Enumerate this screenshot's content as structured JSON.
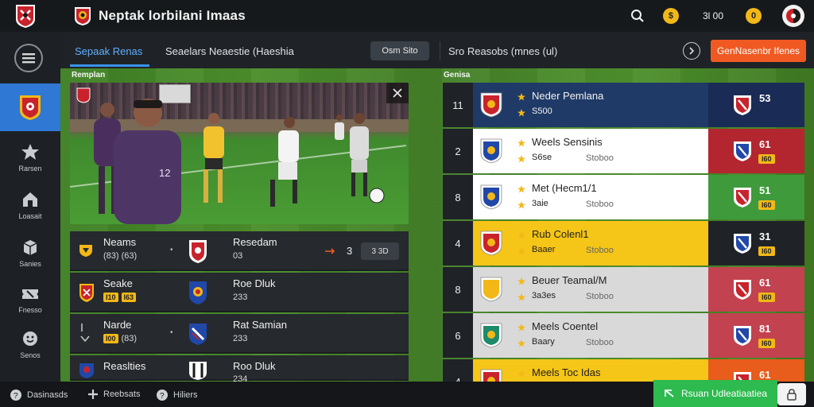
{
  "app": {
    "title": "Neptak lorbilani Imaas"
  },
  "top_bar": {
    "balance": "3l 00",
    "coin_glyph": "$",
    "coin2_glyph": "0"
  },
  "rail": {
    "items": [
      {
        "label": "Rarsen",
        "icon": "star-icon"
      },
      {
        "label": "Loasait",
        "icon": "house-icon"
      },
      {
        "label": "Sanies",
        "icon": "box-icon"
      },
      {
        "label": "Fnesso",
        "icon": "ticket-icon"
      },
      {
        "label": "Senos",
        "icon": "smile-icon"
      }
    ]
  },
  "subnav": {
    "tab_active": "Sepaak Renas",
    "tab_2": "Seaelars Neaestie (Haeshia",
    "pill": "Osm Sito",
    "info": "Sro Reasobs (mnes (ul)",
    "cta": "GenNasenbr Ifenes"
  },
  "labels": {
    "video_section": "Remplan",
    "standings_section": "Genisa"
  },
  "matches": [
    {
      "name": "Neams",
      "sub": "(83) (63)",
      "team": "Resedam",
      "time": "03",
      "odds": "3 3D",
      "marker": "3"
    },
    {
      "name": "Seake",
      "tags": [
        "I10",
        "I63"
      ],
      "team": "Roe Dluk",
      "time": "233"
    },
    {
      "name": "Narde",
      "sub": "(83)",
      "tag_prefix": "I00",
      "team": "Rat Samian",
      "time": "233"
    },
    {
      "name": "Reaslties",
      "team": "Roo Dluk",
      "time": "234"
    }
  ],
  "standings": [
    {
      "rank": "11",
      "team": "Neder Pemlana",
      "pts": "S500",
      "sub": "",
      "score": "53",
      "chip": ""
    },
    {
      "rank": "2",
      "team": "Weels Sensinis",
      "pts": "S6se",
      "sub": "Stoboo",
      "score": "61",
      "chip": "l60"
    },
    {
      "rank": "8",
      "team": "Met (Hecm1/1",
      "pts": "3aie",
      "sub": "Stoboo",
      "score": "51",
      "chip": "l60"
    },
    {
      "rank": "4",
      "team": "Rub Colenl1",
      "pts": "Baaer",
      "sub": "Stoboo",
      "score": "31",
      "chip": "l60"
    },
    {
      "rank": "8",
      "team": "Beuer Teamal/M",
      "pts": "3a3es",
      "sub": "Stoboo",
      "score": "61",
      "chip": "l60"
    },
    {
      "rank": "6",
      "team": "Meels Coentel",
      "pts": "Baary",
      "sub": "Stoboo",
      "score": "81",
      "chip": "l60"
    },
    {
      "rank": "4",
      "team": "Meels Toc Idas",
      "pts": "",
      "sub": "",
      "score": "61",
      "chip": ""
    }
  ],
  "standing_colors": [
    "#1f3a66",
    "#ffffff",
    "#ffffff",
    "#f5c518",
    "#d9d9d9",
    "#d9d9d9",
    "#f5c518"
  ],
  "standing_right_colors": [
    "#1a2c55",
    "#b3262f",
    "#3f9a3c",
    "#1f2327",
    "#c2424f",
    "#c2424f",
    "#e85c1c"
  ],
  "footer": {
    "item1": "Dasinasds",
    "item2": "Reebsats",
    "item3": "Hiliers",
    "green_button": "Rsuan Udleatiaatiea"
  }
}
